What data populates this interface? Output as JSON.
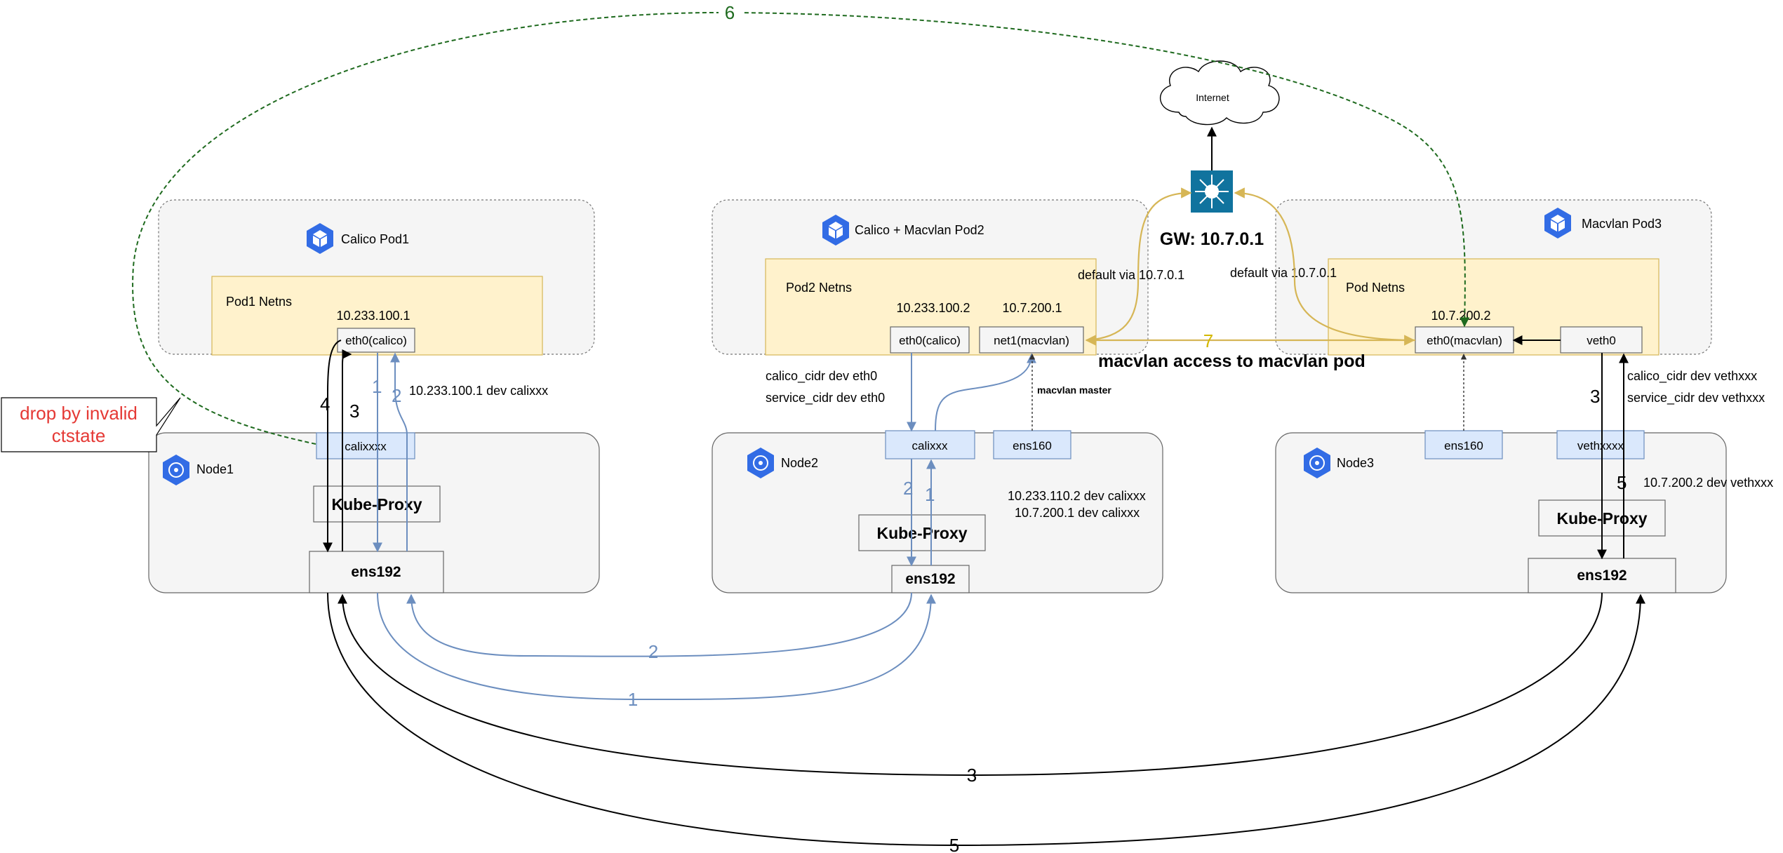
{
  "pods": {
    "pod1": {
      "title": "Calico Pod1",
      "netns": "Pod1 Netns",
      "ip": "10.233.100.1",
      "iface": "eth0(calico)"
    },
    "pod2": {
      "title": "Calico + Macvlan Pod2",
      "netns": "Pod2 Netns",
      "ip1": "10.233.100.2",
      "ip2": "10.7.200.1",
      "iface1": "eth0(calico)",
      "iface2": "net1(macvlan)"
    },
    "pod3": {
      "title": "Macvlan Pod3",
      "netns": "Pod Netns",
      "ip": "10.7.200.2",
      "iface1": "eth0(macvlan)",
      "iface2": "veth0"
    }
  },
  "nodes": {
    "node1": {
      "title": "Node1",
      "cali": "calixxxx",
      "proxy": "Kube-Proxy",
      "nic": "ens192"
    },
    "node2": {
      "title": "Node2",
      "cali": "calixxx",
      "mac": "ens160",
      "proxy": "Kube-Proxy",
      "nic": "ens192"
    },
    "node3": {
      "title": "Node3",
      "mac": "ens160",
      "veth": "vethxxxx",
      "proxy": "Kube-Proxy",
      "nic": "ens192"
    }
  },
  "internet": "Internet",
  "gateway": "GW: 10.7.0.1",
  "routes": {
    "pod1_route": "10.233.100.1 dev calixxx",
    "pod2_route_a": "calico_cidr dev eth0",
    "pod2_route_b": "service_cidr dev eth0",
    "node2_route_a": "10.233.110.2 dev calixxx",
    "node2_route_b": "10.7.200.1 dev calixxx",
    "macvlan_master": "macvlan master",
    "default_left": "default via 10.7.0.1",
    "default_right": "default via 10.7.0.1",
    "pod3_route_a": "calico_cidr dev vethxxx",
    "pod3_route_b": "service_cidr dev vethxxx",
    "node3_route": "10.7.200.2 dev vethxxx"
  },
  "macvlan_access": "macvlan access to macvlan pod",
  "callout": {
    "line1": "drop by invalid",
    "line2": "ctstate"
  },
  "path_labels": {
    "p1_left": "4",
    "p2_left": "3",
    "p3_left": "1",
    "p4_left": "2",
    "n2_a": "2",
    "n2_b": "1",
    "arc_blue_top": "2",
    "arc_blue_bottom": "1",
    "arc_black_top": "3",
    "arc_black_bottom": "5",
    "n3_a": "3",
    "n3_b": "5",
    "macvlan_seq": "7",
    "green_seq": "6"
  },
  "colors": {
    "netns": "#fff2cc",
    "blue_iface": "#dae8fc",
    "blue_path": "#6c8ebf",
    "gold_path": "#d6b656",
    "green_path": "#1e6a1e",
    "gateway": "#10739e",
    "pod_icon": "#326ce5",
    "red": "#e53935"
  }
}
